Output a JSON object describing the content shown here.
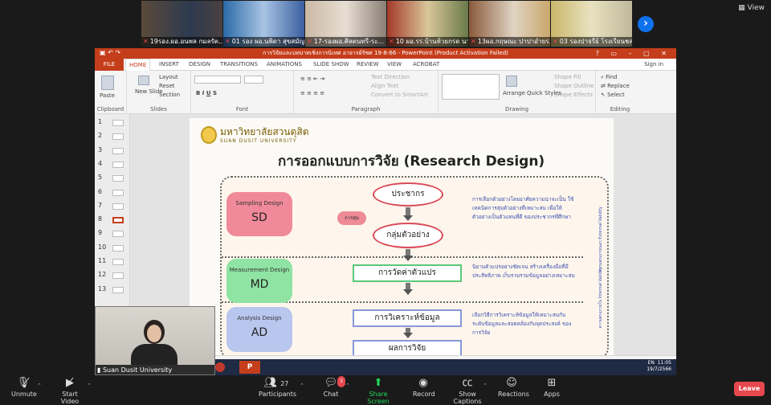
{
  "participants": [
    {
      "name": "19รอง.ผอ.อนพล  กมลรัต..."
    },
    {
      "name": "01 รอง ผอ.นพิดา สุขสมัญ..."
    },
    {
      "name": "17-รองผอ.ศิลตนทรี-ระ..."
    },
    {
      "name": "10 ผอ.รร.บ้านห้วยกรด นา..."
    },
    {
      "name": "13ผอ.กฤษณะ ปาปาอำยร..."
    },
    {
      "name": "03 รองปาจรีย์ โรงเรียนชล..."
    }
  ],
  "view_label": "View",
  "ppt": {
    "window_title": "การวิจัยและบทบาทเชิงการนิเทศ อาจารย์รัชศ 19-8-66 - PowerPoint (Product Activation Failed)",
    "file_tab": "FILE",
    "tabs": [
      "HOME",
      "INSERT",
      "DESIGN",
      "TRANSITIONS",
      "ANIMATIONS",
      "SLIDE SHOW",
      "REVIEW",
      "VIEW",
      "ACROBAT"
    ],
    "sign_in": "Sign in",
    "ribbon": {
      "clipboard": {
        "label": "Clipboard",
        "paste": "Paste"
      },
      "slides": {
        "label": "Slides",
        "new_slide": "New Slide",
        "layout": "Layout",
        "reset": "Reset",
        "section": "Section"
      },
      "font": {
        "label": "Font"
      },
      "paragraph": {
        "label": "Paragraph",
        "text_direction": "Text Direction",
        "align_text": "Align Text",
        "convert": "Convert to SmartArt"
      },
      "drawing": {
        "label": "Drawing",
        "arrange": "Arrange",
        "quick_styles": "Quick Styles",
        "shape_fill": "Shape Fill",
        "shape_outline": "Shape Outline",
        "shape_effects": "Shape Effects"
      },
      "editing": {
        "label": "Editing",
        "find": "Find",
        "replace": "Replace",
        "select": "Select"
      }
    },
    "thumbnails": [
      "1",
      "2",
      "3",
      "4",
      "5",
      "6",
      "7",
      "8",
      "9",
      "10",
      "11",
      "12",
      "13"
    ],
    "selected_thumbnail": "8",
    "slide": {
      "logo_th": "มหาวิทยาลัยสวนดุสิต",
      "logo_en": "SUAN DUSIT UNIVERSITY",
      "title": "การออกแบบการวิจัย (Research Design)",
      "sampling": {
        "name": "Sampling Design",
        "abbr": "SD",
        "color": "#f08a9a"
      },
      "measurement": {
        "name": "Measurement Design",
        "abbr": "MD",
        "color": "#8fe3a3"
      },
      "analysis": {
        "name": "Analysis Design",
        "abbr": "AD",
        "color": "#b9c6ee"
      },
      "population": "ประชากร",
      "sample": "กลุ่มตัวอย่าง",
      "sampling_pill": "การสุ่ม",
      "measure_box": "การวัดค่าตัวแปร",
      "analysis_box": "การวิเคราะห์ข้อมูล",
      "result_box": "ผลการวิจัย",
      "desc_sampling": "การเลือกตัวอย่างโดยอาศัยความน่าจะเป็น ใช้เทคนิคการสุ่มตัวอย่างที่เหมาะสม เพื่อให้ตัวอย่างเป็นตัวแทนที่ดี ของประชากรที่ศึกษา",
      "desc_measure": "นิยามตัวแปรอย่างชัดเจน สร้างเครื่องมือที่มีประสิทธิภาพ เก็บรวบรวมข้อมูลอย่างเหมาะสม",
      "desc_analysis": "เลือกวิธีการวิเคราะห์ข้อมูลให้เหมาะสมกับ ระดับข้อมูลและสอดคล้องกับจุดประสงค์ ของการวิจัย",
      "external_validity": "ความตรงภายนอก External Validity",
      "internal_validity": "ความตรงภายใน Internal Validity"
    },
    "taskbar_time": "11:05",
    "taskbar_date": "19/7/2566",
    "taskbar_lang": "EN"
  },
  "self_view": {
    "name": "Suan Dusit University"
  },
  "toolbar": {
    "unmute": "Unmute",
    "start_video": "Start Video",
    "participants": "Participants",
    "participants_count": "27",
    "chat": "Chat",
    "chat_badge": "3",
    "share_screen": "Share Screen",
    "record": "Record",
    "show_captions": "Show Captions",
    "reactions": "Reactions",
    "apps": "Apps",
    "leave": "Leave"
  }
}
